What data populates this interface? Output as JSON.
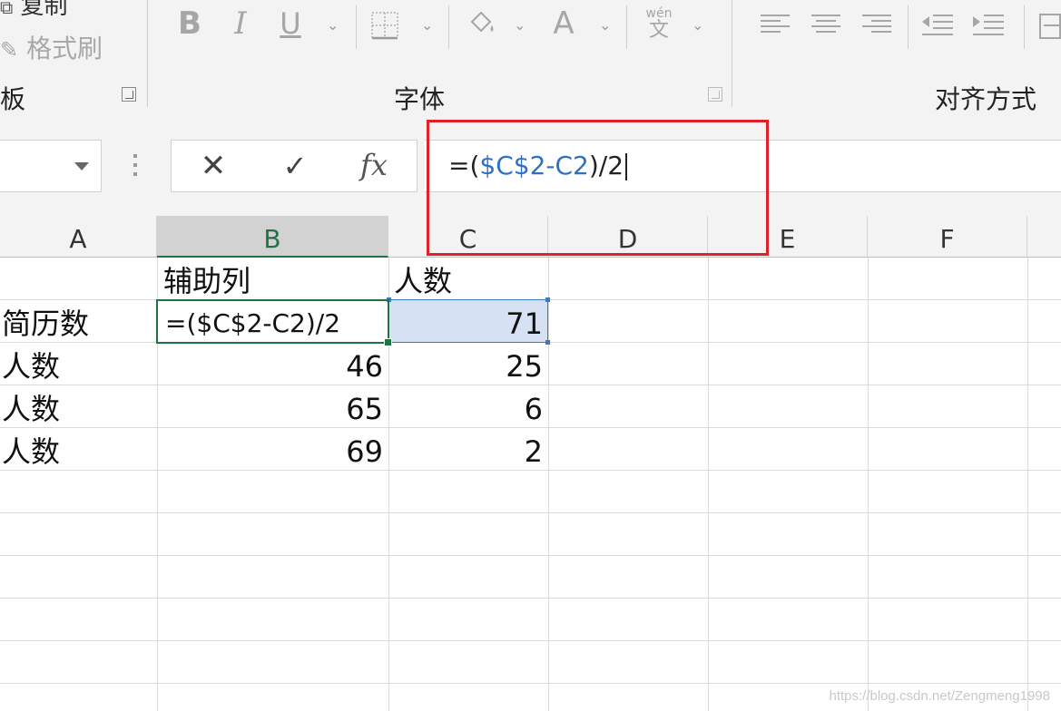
{
  "ribbon": {
    "clipboard": {
      "copy_label": "复制",
      "format_painter_label": "格式刷",
      "group_label": "板"
    },
    "font": {
      "bold": "B",
      "italic": "I",
      "underline": "U",
      "font_color": "A",
      "phonetic_pinyin": "wén",
      "phonetic_char": "文",
      "group_label": "字体"
    },
    "alignment": {
      "group_label": "对齐方式"
    }
  },
  "formula_bar": {
    "cancel_glyph": "✕",
    "enter_glyph": "✓",
    "fx_label": "fx",
    "formula_prefix": "=(",
    "formula_ref1": "$C$2",
    "formula_minus": "-",
    "formula_ref2": "C2",
    "formula_suffix": ")/2"
  },
  "columns": [
    "A",
    "B",
    "C",
    "D",
    "E",
    "F"
  ],
  "rows": [
    {
      "a": "",
      "b": "辅助列",
      "c": "人数"
    },
    {
      "a": "简历数",
      "b": "=($C$2-C2)/2",
      "c": "71"
    },
    {
      "a": "人数",
      "b": "46",
      "c": "25"
    },
    {
      "a": "人数",
      "b": "65",
      "c": "6"
    },
    {
      "a": "人数",
      "b": "69",
      "c": "2"
    }
  ],
  "watermark": "https://blog.csdn.net/Zengmeng1998",
  "colors": {
    "excel_green": "#217346",
    "reference_blue": "#2f6fc4",
    "annotation_red": "#e0202a"
  }
}
